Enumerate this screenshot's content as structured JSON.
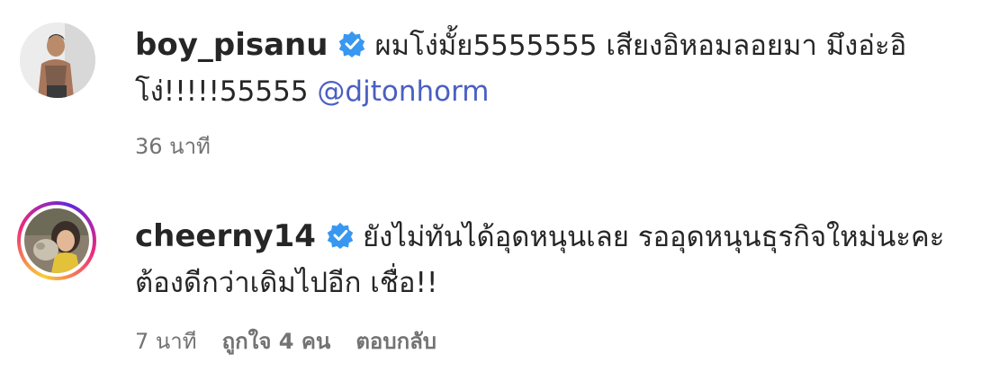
{
  "comments": [
    {
      "username": "boy_pisanu",
      "verified": true,
      "text": "ผมโง่มั้ย5555555 เสียงอิหอมลอยมา มึงอ่ะอิโง่!!!!!55555 ",
      "mention": "@djtonhorm",
      "time": "36 นาที"
    },
    {
      "username": "cheerny14",
      "verified": true,
      "text": "ยังไม่ทันได้อุดหนุนเลย รออุดหนุนธุรกิจใหม่นะคะ ต้องดีกว่าเดิมไปอีก เชื่อ!!",
      "time": "7 นาที",
      "likes": "ถูกใจ 4 คน",
      "reply": "ตอบกลับ"
    }
  ],
  "colors": {
    "verified_badge": "#3897f0",
    "mention": "#4a5fc1",
    "story_ring": [
      "#f9ce34",
      "#ee2a7b",
      "#6228d7"
    ]
  }
}
